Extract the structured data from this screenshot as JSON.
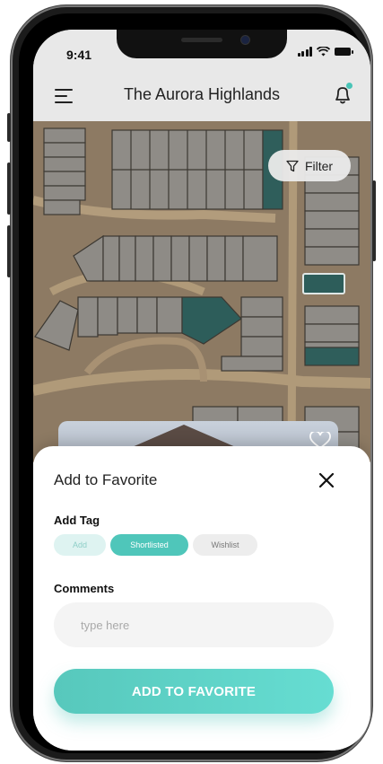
{
  "status": {
    "time": "9:41"
  },
  "header": {
    "title": "The Aurora Highlands",
    "menu_icon": "hamburger-menu-icon",
    "notification_icon": "bell-icon"
  },
  "map": {
    "filter_label": "Filter",
    "filter_icon": "funnel-icon"
  },
  "sheet": {
    "title": "Add to Favorite",
    "close_icon": "close-icon",
    "tag_section_label": "Add Tag",
    "tags": [
      {
        "label": "Add",
        "state": "default"
      },
      {
        "label": "Shortlisted",
        "state": "selected"
      },
      {
        "label": "Wishlist",
        "state": "default"
      }
    ],
    "comments_label": "Comments",
    "comments_placeholder": "type here",
    "submit_label": "ADD TO FAVORITE"
  },
  "colors": {
    "accent": "#4fc6ba",
    "accent_light": "#def3f1",
    "map_ground": "#8f7c65",
    "highlight_lot": "#2d5d5a"
  }
}
